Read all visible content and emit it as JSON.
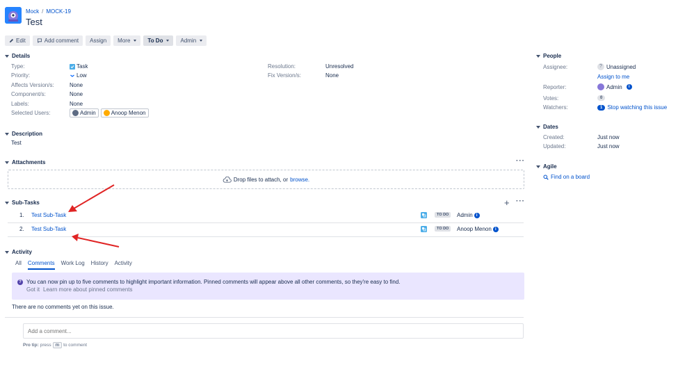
{
  "breadcrumb": {
    "project": "Mock",
    "issue_key": "MOCK-19"
  },
  "issue_title": "Test",
  "toolbar": {
    "edit": "Edit",
    "add_comment": "Add comment",
    "assign": "Assign",
    "more": "More",
    "status": "To Do",
    "admin": "Admin"
  },
  "details": {
    "heading": "Details",
    "type_label": "Type:",
    "type_value": "Task",
    "priority_label": "Priority:",
    "priority_value": "Low",
    "affects_label": "Affects Version/s:",
    "affects_value": "None",
    "component_label": "Component/s:",
    "component_value": "None",
    "labels_label": "Labels:",
    "labels_value": "None",
    "selected_users_label": "Selected Users:",
    "selected_users": [
      "Admin",
      "Anoop Menon"
    ],
    "resolution_label": "Resolution:",
    "resolution_value": "Unresolved",
    "fix_label": "Fix Version/s:",
    "fix_value": "None"
  },
  "description": {
    "heading": "Description",
    "text": "Test"
  },
  "attachments": {
    "heading": "Attachments",
    "drop_text": "Drop files to attach, or",
    "browse": "browse."
  },
  "subtasks": {
    "heading": "Sub-Tasks",
    "items": [
      {
        "index": "1.",
        "summary": "Test Sub-Task",
        "status": "TO DO",
        "assignee": "Admin"
      },
      {
        "index": "2.",
        "summary": "Test Sub-Task",
        "status": "TO DO",
        "assignee": "Anoop Menon"
      }
    ]
  },
  "activity": {
    "heading": "Activity",
    "tabs": [
      "All",
      "Comments",
      "Work Log",
      "History",
      "Activity"
    ],
    "active_tab": "Comments",
    "pinned_notice": "You can now pin up to five comments to highlight important information. Pinned comments will appear above all other comments, so they're easy to find.",
    "got_it": "Got it",
    "learn_more": "Learn more about pinned comments",
    "no_comments": "There are no comments yet on this issue.",
    "comment_placeholder": "Add a comment...",
    "pro_tip_prefix": "Pro tip:",
    "pro_tip_press": "press",
    "pro_tip_key": "m",
    "pro_tip_suffix": "to comment"
  },
  "people": {
    "heading": "People",
    "assignee_label": "Assignee:",
    "assignee_value": "Unassigned",
    "assign_to_me": "Assign to me",
    "reporter_label": "Reporter:",
    "reporter_value": "Admin",
    "votes_label": "Votes:",
    "votes_value": "0",
    "watchers_label": "Watchers:",
    "watchers_count": "1",
    "watchers_action": "Stop watching this issue"
  },
  "dates": {
    "heading": "Dates",
    "created_label": "Created:",
    "created_value": "Just now",
    "updated_label": "Updated:",
    "updated_value": "Just now"
  },
  "agile": {
    "heading": "Agile",
    "find_board": "Find on a board"
  },
  "colors": {
    "link": "#0052cc",
    "annotation_arrow": "#e02424",
    "notice_bg": "#eae6ff"
  }
}
